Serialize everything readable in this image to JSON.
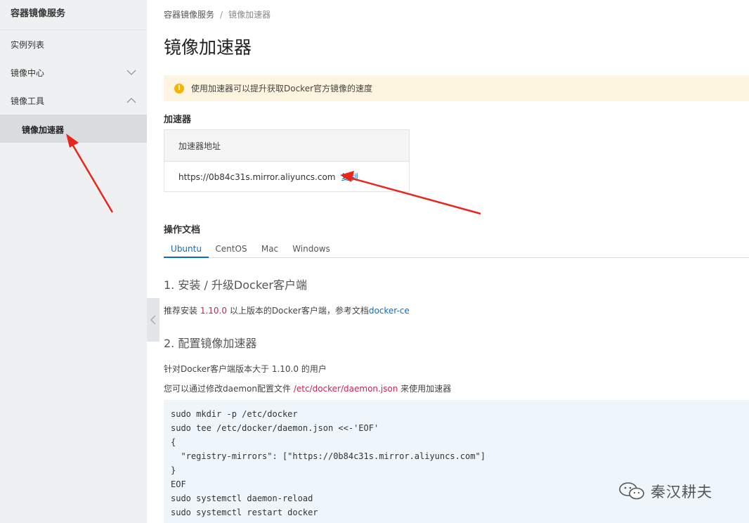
{
  "sidebar": {
    "title": "容器镜像服务",
    "items": [
      {
        "label": "实例列表"
      },
      {
        "label": "镜像中心",
        "chevron": "down"
      },
      {
        "label": "镜像工具",
        "chevron": "up"
      }
    ],
    "sub_item": "镜像加速器"
  },
  "breadcrumb": {
    "root": "容器镜像服务",
    "sep": "/",
    "current": "镜像加速器"
  },
  "page_title": "镜像加速器",
  "notice": {
    "icon": "warning-icon",
    "text": "使用加速器可以提升获取Docker官方镜像的速度"
  },
  "accelerator": {
    "section_title": "加速器",
    "header": "加速器地址",
    "address": "https://0b84c31s.mirror.aliyuncs.com",
    "copy_label": "复制"
  },
  "docs": {
    "section_title": "操作文档",
    "tabs": [
      "Ubuntu",
      "CentOS",
      "Mac",
      "Windows"
    ],
    "active_tab": "Ubuntu",
    "step1_title": "1. 安装 / 升级Docker客户端",
    "step1_text_a": "推荐安装 ",
    "step1_version": "1.10.0",
    "step1_text_b": " 以上版本的Docker客户端，参考文档",
    "step1_link": "docker-ce",
    "step2_title": "2. 配置镜像加速器",
    "step2_line1": "针对Docker客户端版本大于 1.10.0 的用户",
    "step2_line2_a": "您可以通过修改daemon配置文件 ",
    "step2_path": "/etc/docker/daemon.json",
    "step2_line2_b": " 来使用加速器",
    "code": "sudo mkdir -p /etc/docker\nsudo tee /etc/docker/daemon.json <<-'EOF'\n{\n  \"registry-mirrors\": [\"https://0b84c31s.mirror.aliyuncs.com\"]\n}\nEOF\nsudo systemctl daemon-reload\nsudo systemctl restart docker"
  },
  "watermark": "秦汉耕夫",
  "colors": {
    "accent": "#0a6ebd",
    "annotation": "#e8261b",
    "notice_bg": "#fdf5df",
    "code_bg": "#eef5fb"
  }
}
